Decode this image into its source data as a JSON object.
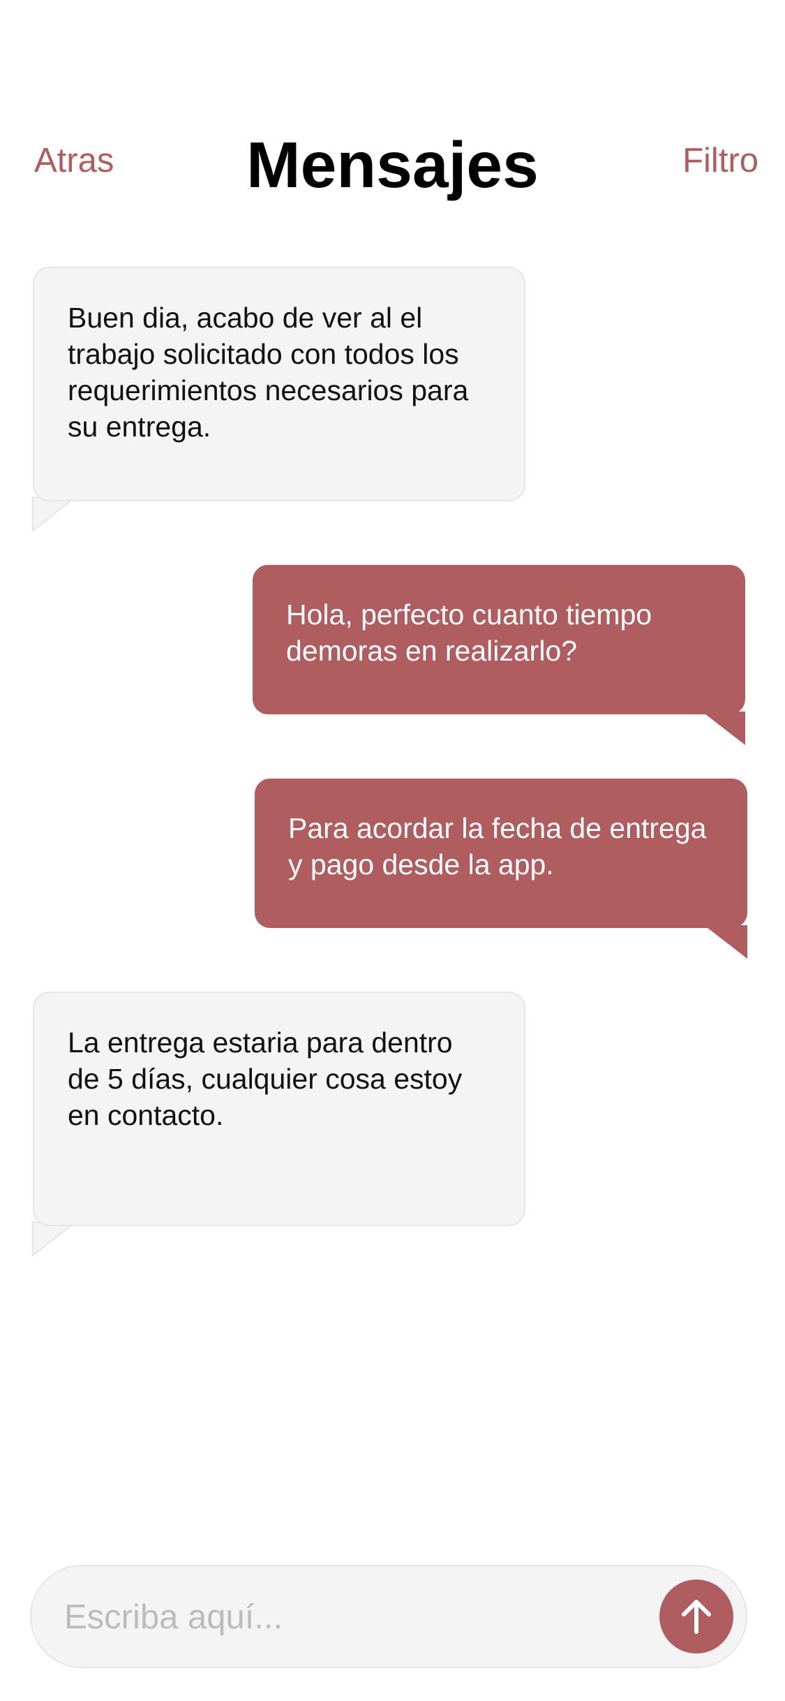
{
  "header": {
    "back_label": "Atras",
    "title": "Mensajes",
    "filter_label": "Filtro"
  },
  "messages": [
    {
      "direction": "incoming",
      "text": "Buen dia, acabo de ver al el trabajo solicitado con todos los requerimientos necesarios para su entrega."
    },
    {
      "direction": "outgoing",
      "text": "Hola, perfecto cuanto tiempo demoras en realizarlo?"
    },
    {
      "direction": "outgoing",
      "text": "Para acordar la fecha de entrega y pago desde la app."
    },
    {
      "direction": "incoming",
      "text": "La entrega  estaria para dentro de 5 días, cualquier cosa estoy en contacto."
    }
  ],
  "composer": {
    "placeholder": "Escriba aquí...",
    "send_icon": "arrow-up-icon"
  },
  "colors": {
    "accent": "#af5d5e",
    "incoming_bubble": "#f4f4f4",
    "bubble_border": "#e6e6e6",
    "background": "#ffffff"
  }
}
